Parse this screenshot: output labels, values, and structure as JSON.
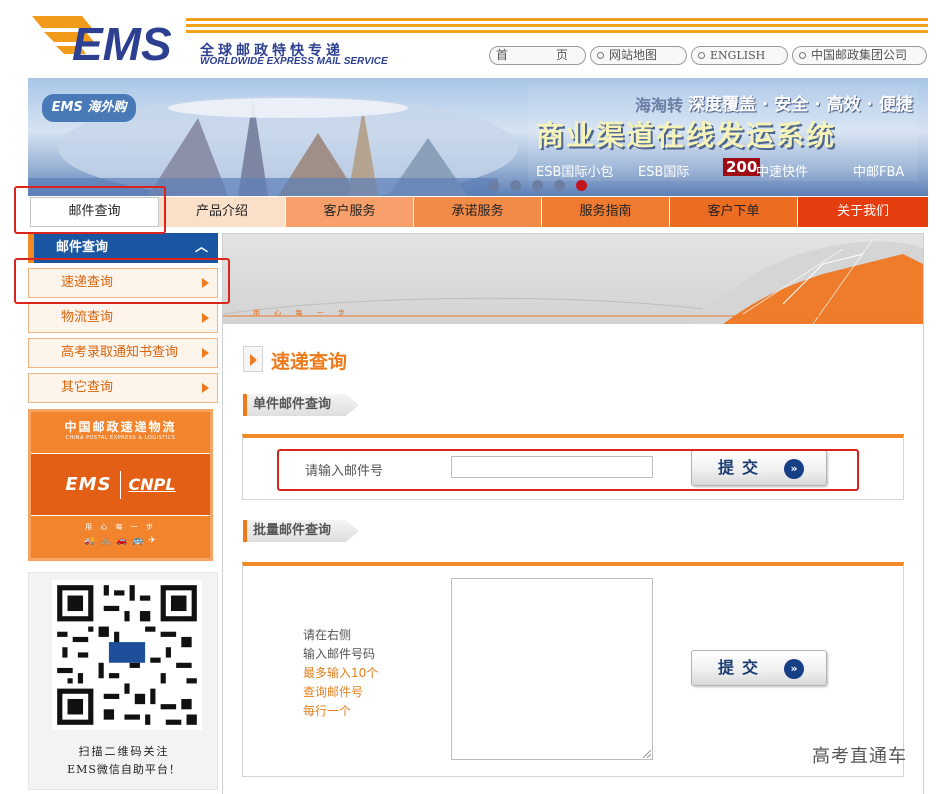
{
  "header": {
    "logo_text": "EMS",
    "slogan_cn": "全球邮政特快专递",
    "slogan_en": "WORLDWIDE EXPRESS MAIL SERVICE",
    "links": {
      "home_left": "首",
      "home_right": "页",
      "sitemap": "网站地图",
      "english": "ENGLISH",
      "group": "中国邮政集团公司"
    }
  },
  "banner": {
    "logo_text": "EMS 海外购",
    "line1": "海淘转",
    "line2": "深度覆盖 · 安全 · 高效 · 便捷",
    "headline": "商业渠道在线发运系统",
    "tag1": "ESB国际小包",
    "tag2": "ESB国际",
    "tag3": "200",
    "tag4": "中速快件",
    "tag5": "中邮FBA",
    "dots": 5,
    "active_dot": 5
  },
  "nav": {
    "items": [
      "邮件查询",
      "产品介绍",
      "客户服务",
      "承诺服务",
      "服务指南",
      "客户下单",
      "关于我们"
    ]
  },
  "sidebar": {
    "header": "邮件查询",
    "items": [
      "速递查询",
      "物流查询",
      "高考录取通知书查询",
      "其它查询"
    ],
    "card": {
      "cn": "中国邮政速递物流",
      "en": "CHINA POSTAL EXPRESS & LOGISTICS",
      "ems": "EMS",
      "cnpl": "CNPL",
      "motto": "用 心 每 一 步"
    },
    "qr": {
      "caption1": "扫描二维码关注",
      "caption2": "EMS微信自助平台！"
    }
  },
  "main": {
    "banner_motto": "用 心 每 一 步",
    "title": "速递查询",
    "single": {
      "section_label": "单件邮件查询",
      "input_label": "请输入邮件号",
      "input_value": "",
      "submit": "提交"
    },
    "batch": {
      "section_label": "批量邮件查询",
      "hint_gray": [
        "请在右侧",
        "输入邮件号码"
      ],
      "hint_orange": [
        "最多输入10个",
        "查询邮件号",
        "每行一个"
      ],
      "textarea_value": "",
      "submit": "提交"
    }
  },
  "watermark": "高考直通车",
  "colors": {
    "brand_orange": "#ef7a1a",
    "brand_blue": "#1b56a3",
    "highlight_red": "#d9251e"
  }
}
